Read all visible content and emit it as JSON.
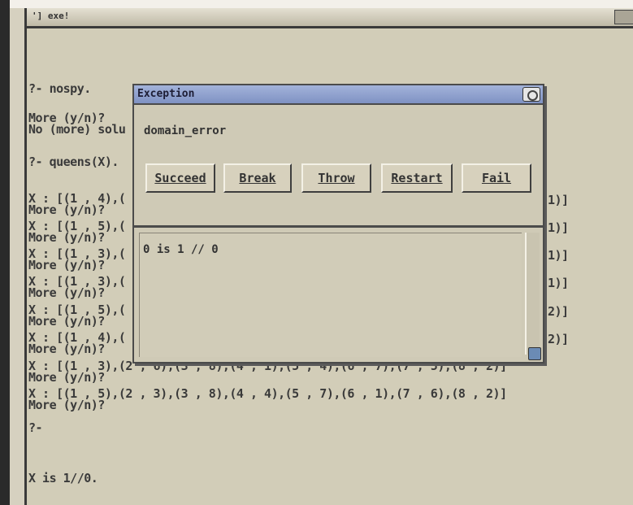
{
  "window": {
    "title": "'] exe!"
  },
  "console": {
    "lines": [
      "?- nospy.",
      "",
      "More (y/n)?",
      "No (more) solu",
      "",
      "?- queens(X).",
      "",
      "X : [(1 , 4),(",
      "More (y/n)?",
      "X : [(1 , 5),(",
      "More (y/n)?",
      "X : [(1 , 3),(",
      "More (y/n)?",
      "X : [(1 , 3),(",
      "More (y/n)?",
      "X : [(1 , 5),(",
      "More (y/n)?",
      "X : [(1 , 4),(",
      "More (y/n)?",
      "X : [(1 , 3),(2 , 6),(3 , 8),(4 , 1),(5 , 4),(6 , 7),(7 , 5),(8 , 2)]",
      "More (y/n)?",
      "X : [(1 , 5),(2 , 3),(3 , 8),(4 , 4),(5 , 7),(6 , 1),(7 , 6),(8 , 2)]",
      "More (y/n)?",
      "?-",
      "",
      "X is 1//0."
    ],
    "right_fragments": [
      "1)]",
      "1)]",
      "1)]",
      "1)]",
      "2)]",
      "2)]"
    ]
  },
  "dialog": {
    "title": "Exception",
    "message": "domain_error",
    "buttons": {
      "succeed": "Succeed",
      "break": "Break",
      "throw": "Throw",
      "restart": "Restart",
      "fail": "Fail"
    },
    "output": "0 is 1 // 0"
  }
}
